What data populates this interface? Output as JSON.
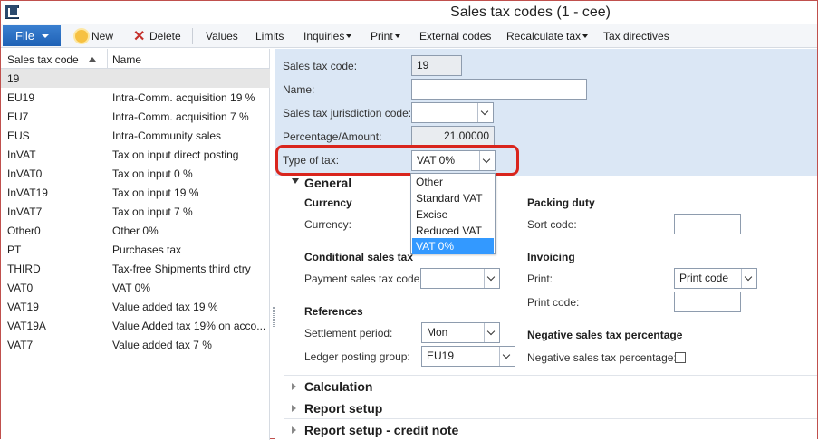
{
  "window": {
    "title": "Sales tax codes (1 - cee)"
  },
  "toolbar": {
    "file": "File",
    "new": "New",
    "delete": "Delete",
    "values": "Values",
    "limits": "Limits",
    "inquiries": "Inquiries",
    "print": "Print",
    "external_codes": "External codes",
    "recalculate_tax": "Recalculate tax",
    "tax_directives": "Tax directives"
  },
  "list": {
    "col_code": "Sales tax code",
    "col_name": "Name",
    "rows": [
      {
        "code": "19",
        "name": ""
      },
      {
        "code": "EU19",
        "name": "Intra-Comm. acquisition 19 %"
      },
      {
        "code": "EU7",
        "name": "Intra-Comm. acquisition 7 %"
      },
      {
        "code": "EUS",
        "name": "Intra-Community sales"
      },
      {
        "code": "InVAT",
        "name": "Tax on input direct posting"
      },
      {
        "code": "InVAT0",
        "name": "Tax on input 0 %"
      },
      {
        "code": "InVAT19",
        "name": "Tax on input 19 %"
      },
      {
        "code": "InVAT7",
        "name": "Tax on input 7 %"
      },
      {
        "code": "Other0",
        "name": "Other 0%"
      },
      {
        "code": "PT",
        "name": "Purchases tax"
      },
      {
        "code": "THIRD",
        "name": "Tax-free Shipments third ctry"
      },
      {
        "code": "VAT0",
        "name": "VAT 0%"
      },
      {
        "code": "VAT19",
        "name": "Value added tax 19 %"
      },
      {
        "code": "VAT19A",
        "name": "Value Added tax 19% on acco..."
      },
      {
        "code": "VAT7",
        "name": "Value added tax 7 %"
      }
    ]
  },
  "header_form": {
    "code_label": "Sales tax code:",
    "code_value": "19",
    "name_label": "Name:",
    "name_value": "",
    "jurisdiction_label": "Sales tax jurisdiction code:",
    "jurisdiction_value": "",
    "percentage_label": "Percentage/Amount:",
    "percentage_value": "21.00000",
    "type_label": "Type of tax:",
    "type_value": "VAT 0%"
  },
  "type_dropdown": {
    "options": [
      "Other",
      "Standard VAT",
      "Excise",
      "Reduced VAT",
      "VAT 0%"
    ],
    "selected": "VAT 0%"
  },
  "general": {
    "title": "General",
    "currency_group": "Currency",
    "currency_label": "Currency:",
    "conditional_group": "Conditional sales tax",
    "payment_code_label": "Payment sales tax code:",
    "payment_code_value": "",
    "references_group": "References",
    "settlement_label": "Settlement period:",
    "settlement_value": "Mon",
    "ledger_label": "Ledger posting group:",
    "ledger_value": "EU19",
    "packing_group": "Packing duty",
    "sort_code_label": "Sort code:",
    "invoicing_group": "Invoicing",
    "print_label": "Print:",
    "print_value": "Print code",
    "print_code_label": "Print code:",
    "negative_group": "Negative sales tax percentage",
    "negative_label": "Negative sales tax percentage:",
    "negative_checked": false
  },
  "fasttabs": [
    "Calculation",
    "Report setup",
    "Report setup - credit note"
  ],
  "colors": {
    "accent": "#1f62b6",
    "highlight": "#d9251d",
    "form_bg": "#dbe7f5",
    "selection": "#3399ff"
  }
}
